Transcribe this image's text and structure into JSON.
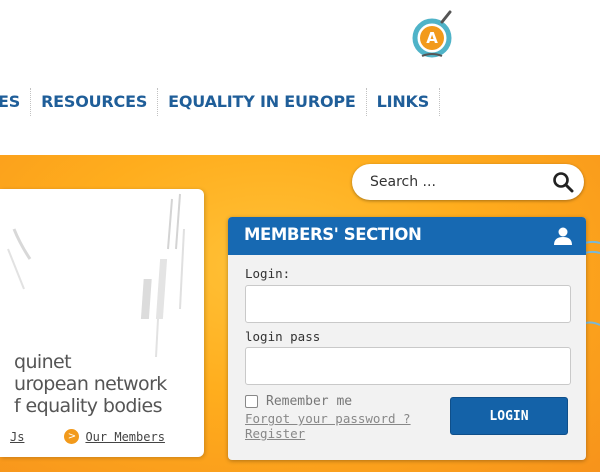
{
  "logo": {
    "icon": "equinet-a-logo-icon",
    "letter": "A",
    "colors": {
      "orange": "#f29a1b",
      "teal": "#4fb3c8"
    }
  },
  "nav": {
    "items": [
      {
        "label": "ES"
      },
      {
        "label": "RESOURCES"
      },
      {
        "label": "EQUALITY IN EUROPE"
      },
      {
        "label": "LINKS"
      }
    ]
  },
  "search": {
    "placeholder": "Search ...",
    "icon": "search-icon"
  },
  "card": {
    "title_lines": [
      "quinet",
      "uropean network",
      "f equality bodies"
    ],
    "link_left": "Js",
    "link_right": "Our Members",
    "arrow_glyph": ">"
  },
  "members": {
    "title": "MEMBERS' SECTION",
    "login_label": "Login:",
    "pass_label": "login pass",
    "remember_label": "Remember me",
    "forgot_label": "Forgot your password ?",
    "register_label": "Register",
    "login_button": "LOGIN"
  },
  "colors": {
    "nav_text": "#1f5e99",
    "banner_orange": "#ffad1d",
    "panel_blue": "#1769b2",
    "button_blue": "#1462a8"
  }
}
